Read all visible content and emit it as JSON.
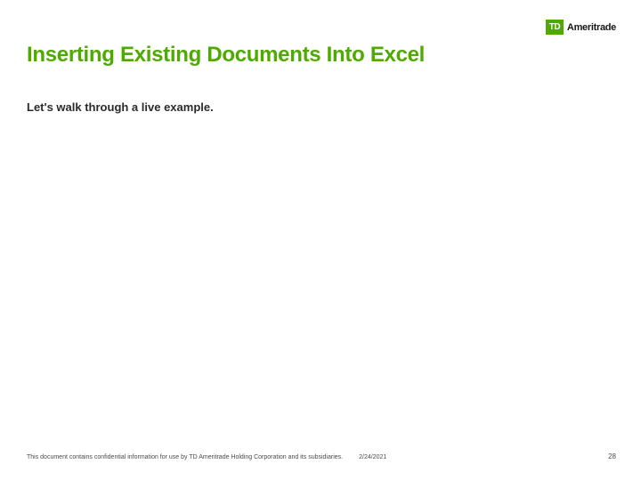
{
  "logo": {
    "box_text": "TD",
    "brand_text": "Ameritrade"
  },
  "title": "Inserting Existing Documents Into Excel",
  "body": "Let's walk through a live example.",
  "footer": {
    "confidentiality": "This document contains confidential information for use by TD Ameritrade Holding Corporation and its subsidiaries.",
    "date": "2/24/2021",
    "page": "28"
  }
}
